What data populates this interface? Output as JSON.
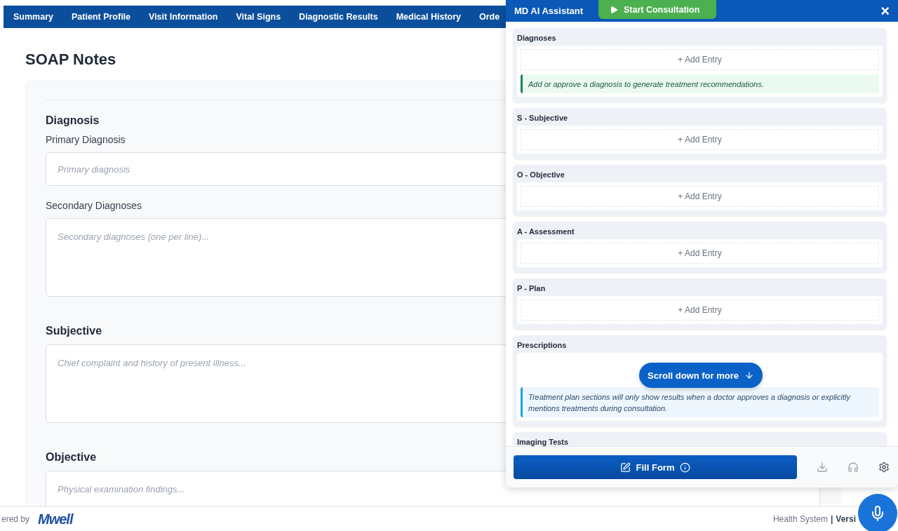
{
  "nav": {
    "tabs": [
      "Summary",
      "Patient Profile",
      "Visit Information",
      "Vital Signs",
      "Diagnostic Results",
      "Medical History",
      "Orde"
    ]
  },
  "page": {
    "title": "SOAP Notes",
    "groups": [
      {
        "heading": "Diagnosis",
        "fields": [
          {
            "label": "Primary Diagnosis",
            "placeholder": "Primary diagnosis",
            "kind": "input"
          },
          {
            "label": "Secondary Diagnoses",
            "placeholder": "Secondary diagnoses (one per line)...",
            "kind": "textarea"
          }
        ]
      },
      {
        "heading": "Subjective",
        "fields": [
          {
            "placeholder": "Chief complaint and history of present illness...",
            "kind": "textarea"
          }
        ]
      },
      {
        "heading": "Objective",
        "fields": [
          {
            "placeholder": "Physical examination findings...",
            "kind": "textarea"
          }
        ]
      }
    ]
  },
  "footer": {
    "powered": "ered by",
    "logo": "Mwell",
    "system": "Health System",
    "separator": "|",
    "version": "Versi"
  },
  "assistant": {
    "title": "MD AI Assistant",
    "start_button": "Start Consultation",
    "close": "×",
    "sections": [
      {
        "title": "Diagnoses",
        "add": "+ Add Entry",
        "note": {
          "kind": "success",
          "text": "Add or approve a diagnosis to generate treatment recommendations."
        }
      },
      {
        "title": "S - Subjective",
        "add": "+ Add Entry"
      },
      {
        "title": "O - Objective",
        "add": "+ Add Entry"
      },
      {
        "title": "A - Assessment",
        "add": "+ Add Entry"
      },
      {
        "title": "P - Plan",
        "add": "+ Add Entry"
      },
      {
        "title": "Prescriptions",
        "note": {
          "kind": "info",
          "text": "Treatment plan sections will only show results when a doctor approves a diagnosis or explicitly mentions treatments during consultation."
        }
      },
      {
        "title": "Imaging Tests"
      }
    ],
    "scroll_hint": "Scroll down for more",
    "fill_button": "Fill Form"
  }
}
